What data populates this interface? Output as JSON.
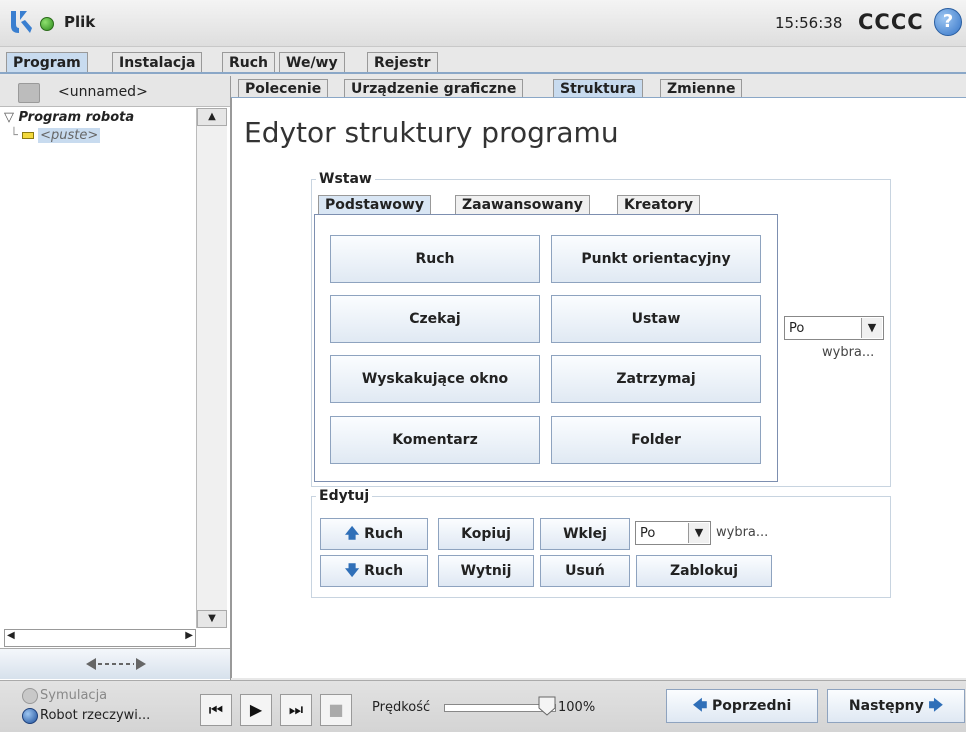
{
  "header": {
    "app_menu": "Plik",
    "time": "15:56:38",
    "robot_name": "CCCC",
    "help_symbol": "?"
  },
  "main_tabs": [
    {
      "label": "Program"
    },
    {
      "label": "Instalacja"
    },
    {
      "label": "Ruch"
    },
    {
      "label": "We/wy"
    },
    {
      "label": "Rejestr"
    }
  ],
  "left": {
    "filename": "<unnamed>",
    "tree_root": "Program robota",
    "tree_child": "<puste>"
  },
  "sub_tabs": [
    {
      "label": "Polecenie"
    },
    {
      "label": "Urządzenie graficzne"
    },
    {
      "label": "Struktura"
    },
    {
      "label": "Zmienne"
    }
  ],
  "editor": {
    "title": "Edytor struktury programu",
    "insert_legend": "Wstaw",
    "insert_tabs": [
      {
        "label": "Podstawowy"
      },
      {
        "label": "Zaawansowany"
      },
      {
        "label": "Kreatory"
      }
    ],
    "basic_buttons": [
      "Ruch",
      "Punkt orientacyjny",
      "Czekaj",
      "Ustaw",
      "Wyskakujące okno",
      "Zatrzymaj",
      "Komentarz",
      "Folder"
    ],
    "insert_position": {
      "value": "Po",
      "suffix": "wybra..."
    },
    "edit_legend": "Edytuj",
    "edit_buttons": {
      "move_up": "Ruch",
      "move_down": "Ruch",
      "copy": "Kopiuj",
      "cut": "Wytnij",
      "paste": "Wklej",
      "delete": "Usuń",
      "lock": "Zablokuj"
    },
    "paste_position": {
      "value": "Po",
      "suffix": "wybra..."
    }
  },
  "footer": {
    "simulation": "Symulacja",
    "real_robot": "Robot rzeczywi...",
    "speed_label": "Prędkość",
    "speed_value": "100%",
    "prev": "Poprzedni",
    "next": "Następny"
  },
  "colors": {
    "accent": "#c8dbef",
    "button_border": "#8ea3bf",
    "green_status": "#3a9a28"
  }
}
